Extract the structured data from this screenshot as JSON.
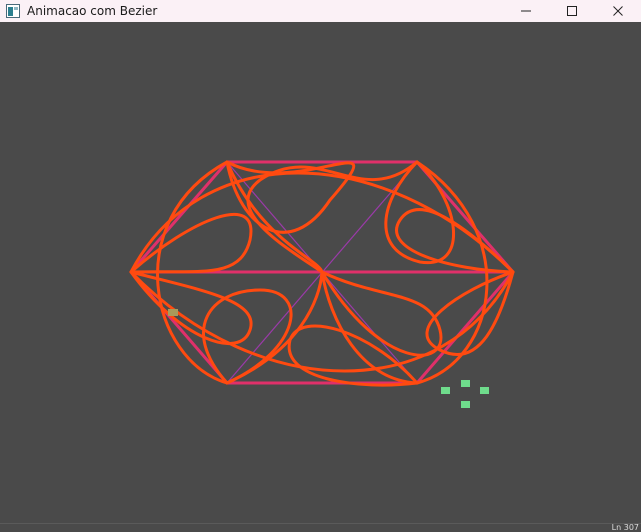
{
  "window": {
    "title": "Animacao com Bezier",
    "icon": "app-window-icon"
  },
  "controls": {
    "minimize_icon": "minimize-icon",
    "maximize_icon": "maximize-icon",
    "close_icon": "close-icon"
  },
  "colors": {
    "background": "#4a4a4a",
    "hexagon_edges": "#e0306a",
    "inner_diagonals": "#9a3aa8",
    "bezier_curves": "#ff4a10",
    "marker_a": "#a89a5a",
    "marker_b": "#6fdc8c"
  },
  "status": {
    "text": "Ln 307"
  }
}
